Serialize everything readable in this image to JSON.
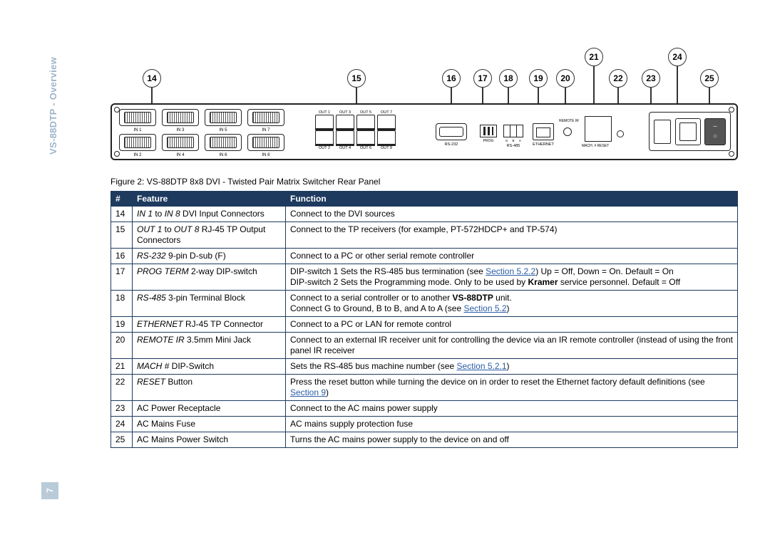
{
  "sidebar": {
    "title": "VS-88DTP - Overview",
    "page": "7"
  },
  "caption": "Figure 2: VS-88DTP 8x8 DVI - Twisted Pair Matrix Switcher Rear Panel",
  "callouts": [
    "14",
    "15",
    "16",
    "17",
    "18",
    "19",
    "20",
    "21",
    "22",
    "23",
    "24",
    "25"
  ],
  "dvi_in": [
    "IN 1",
    "IN 3",
    "IN 5",
    "IN 7",
    "IN 2",
    "IN 4",
    "IN 6",
    "IN 8"
  ],
  "rj_top": [
    "OUT 1",
    "OUT 3",
    "OUT 5",
    "OUT 7"
  ],
  "rj_bot": [
    "OUT 2",
    "OUT 4",
    "OUT 6",
    "OUT 8"
  ],
  "panel_labels": {
    "rs232": "RS-232",
    "prog": "PROG",
    "rs485_pins": [
      "G",
      "B",
      "A"
    ],
    "rs485": "RS-485",
    "eth": "ETHERNET",
    "rir": "REMOTE IR",
    "mach": "MACH. #   RESET"
  },
  "table": {
    "headers": [
      "#",
      "Feature",
      "Function"
    ],
    "rows": [
      {
        "n": "14",
        "feature": [
          {
            "t": "IN 1",
            "i": true
          },
          {
            "t": " to "
          },
          {
            "t": "IN 8",
            "i": true
          },
          {
            "t": " DVI Input Connectors"
          }
        ],
        "func": [
          {
            "t": "Connect to the DVI sources"
          }
        ]
      },
      {
        "n": "15",
        "feature": [
          {
            "t": "OUT 1",
            "i": true
          },
          {
            "t": " to "
          },
          {
            "t": "OUT 8",
            "i": true
          },
          {
            "t": " RJ-45 TP Output Connectors"
          }
        ],
        "func": [
          {
            "t": "Connect to the TP receivers (for example, PT-572HDCP+ and TP-574)"
          }
        ]
      },
      {
        "n": "16",
        "feature": [
          {
            "t": "RS-232",
            "i": true
          },
          {
            "t": " 9-pin D-sub (F)"
          }
        ],
        "func": [
          {
            "t": "Connect to a PC or other serial remote controller"
          }
        ]
      },
      {
        "n": "17",
        "feature": [
          {
            "t": "PROG TERM",
            "i": true
          },
          {
            "t": " 2-way DIP-switch"
          }
        ],
        "func": [
          {
            "t": "DIP-switch 1 Sets the RS-485 bus termination (see "
          },
          {
            "t": "Section 5.2.2",
            "link": true
          },
          {
            "t": ") Up = Off, Down = On. Default = On"
          },
          {
            "br": true
          },
          {
            "t": "DIP-switch 2 Sets the Programming mode. Only to be used by "
          },
          {
            "t": "Kramer",
            "b": true
          },
          {
            "t": " service personnel. Default = Off"
          }
        ]
      },
      {
        "n": "18",
        "feature": [
          {
            "t": "RS-485",
            "i": true
          },
          {
            "t": " 3-pin Terminal Block"
          }
        ],
        "func": [
          {
            "t": "Connect to a serial controller or to another "
          },
          {
            "t": "VS-88DTP",
            "b": true
          },
          {
            "t": " unit."
          },
          {
            "br": true
          },
          {
            "t": "Connect G to Ground, B to B, and A to A (see "
          },
          {
            "t": "Section 5.2",
            "link": true
          },
          {
            "t": ")"
          }
        ]
      },
      {
        "n": "19",
        "feature": [
          {
            "t": "ETHERNET",
            "i": true
          },
          {
            "t": " RJ-45 TP Connector"
          }
        ],
        "func": [
          {
            "t": "Connect to a PC or LAN for remote control"
          }
        ]
      },
      {
        "n": "20",
        "feature": [
          {
            "t": "REMOTE IR",
            "i": true
          },
          {
            "t": " 3.5mm Mini Jack"
          }
        ],
        "func": [
          {
            "t": "Connect to an external IR receiver unit for controlling the device via an IR remote controller (instead of using the front panel IR receiver"
          }
        ]
      },
      {
        "n": "21",
        "feature": [
          {
            "t": "MACH #",
            "i": true
          },
          {
            "t": " DIP-Switch"
          }
        ],
        "func": [
          {
            "t": "Sets the RS-485 bus machine number (see "
          },
          {
            "t": "Section 5.2.1",
            "link": true
          },
          {
            "t": ")"
          }
        ]
      },
      {
        "n": "22",
        "feature": [
          {
            "t": "RESET",
            "i": true
          },
          {
            "t": " Button"
          }
        ],
        "func": [
          {
            "t": "Press the reset button while turning the device on in order to reset the Ethernet factory default definitions (see "
          },
          {
            "t": "Section 9",
            "link": true
          },
          {
            "t": ")"
          }
        ]
      },
      {
        "n": "23",
        "feature": [
          {
            "t": "AC Power Receptacle"
          }
        ],
        "func": [
          {
            "t": "Connect to the AC mains power supply"
          }
        ]
      },
      {
        "n": "24",
        "feature": [
          {
            "t": "AC Mains Fuse"
          }
        ],
        "func": [
          {
            "t": "AC mains supply protection fuse"
          }
        ]
      },
      {
        "n": "25",
        "feature": [
          {
            "t": "AC Mains Power Switch"
          }
        ],
        "func": [
          {
            "t": "Turns the AC mains power supply to the device on and off"
          }
        ]
      }
    ]
  }
}
